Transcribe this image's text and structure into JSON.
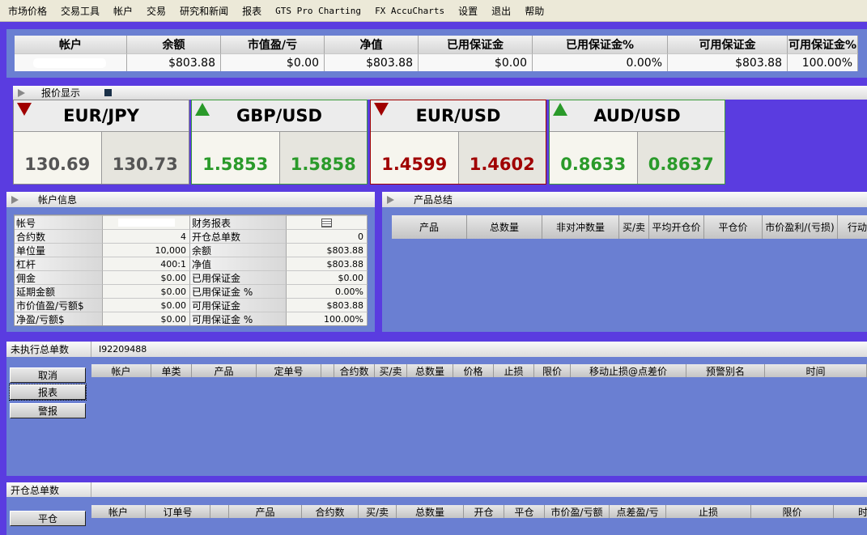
{
  "menu": [
    "市场价格",
    "交易工具",
    "帐户",
    "交易",
    "研究和新闻",
    "报表",
    "GTS Pro Charting",
    "FX AccuCharts",
    "设置",
    "退出",
    "帮助"
  ],
  "summary": {
    "headers": [
      "帐户",
      "余额",
      "市值盈/亏",
      "净值",
      "已用保证金",
      "已用保证金%",
      "可用保证金",
      "可用保证金%"
    ],
    "values": [
      "",
      "$803.88",
      "$0.00",
      "$803.88",
      "$0.00",
      "0.00%",
      "$803.88",
      "100.00%"
    ]
  },
  "quotes": {
    "title": "报价显示",
    "tiles": [
      {
        "pair": "EUR/JPY",
        "bid": "130.69",
        "ask": "130.73",
        "direction": "down",
        "color": "#555555",
        "border": "#888888"
      },
      {
        "pair": "GBP/USD",
        "bid": "1.5853",
        "ask": "1.5858",
        "direction": "up",
        "color": "#2a9a2a",
        "border": "#3a9a3a"
      },
      {
        "pair": "EUR/USD",
        "bid": "1.4599",
        "ask": "1.4602",
        "direction": "down",
        "color": "#a00000",
        "border": "#a00000"
      },
      {
        "pair": "AUD/USD",
        "bid": "0.8633",
        "ask": "0.8637",
        "direction": "up",
        "color": "#2a9a2a",
        "border": "#3a9a3a"
      }
    ]
  },
  "account_info": {
    "title": "帐户信息",
    "rows": [
      [
        "帐号",
        "",
        "财务报表",
        "report-icon"
      ],
      [
        "合约数",
        "4",
        "开仓总单数",
        "0"
      ],
      [
        "单位量",
        "10,000",
        "余额",
        "$803.88"
      ],
      [
        "杠杆",
        "400:1",
        "净值",
        "$803.88"
      ],
      [
        "佣金",
        "$0.00",
        "已用保证金",
        "$0.00"
      ],
      [
        "延期金额",
        "$0.00",
        "已用保证金 %",
        "0.00%"
      ],
      [
        "市价值盈/亏额$",
        "$0.00",
        "可用保证金",
        "$803.88"
      ],
      [
        "净盈/亏额$",
        "$0.00",
        "可用保证金 %",
        "100.00%"
      ]
    ]
  },
  "product_summary": {
    "title": "产品总结",
    "headers": [
      "产品",
      "总数量",
      "非对冲数量",
      "买/卖",
      "平均开仓价",
      "平仓价",
      "市价盈利/(亏损)",
      "行动"
    ]
  },
  "pending": {
    "label": "未执行总单数",
    "value": "I92209488",
    "buttons": [
      "取消",
      "报表",
      "警报"
    ],
    "headers": [
      "帐户",
      "单类",
      "产品",
      "定单号",
      "",
      "合约数",
      "买/卖",
      "总数量",
      "价格",
      "止损",
      "限价",
      "移动止损@点差价",
      "预警别名",
      "时间"
    ]
  },
  "open": {
    "label": "开仓总单数",
    "value": "",
    "buttons": [
      "平仓"
    ],
    "headers": [
      "帐户",
      "订单号",
      "",
      "产品",
      "合约数",
      "买/卖",
      "总数量",
      "开仓",
      "平仓",
      "市价盈/亏额",
      "点差盈/亏",
      "止损",
      "限价",
      "时"
    ]
  }
}
